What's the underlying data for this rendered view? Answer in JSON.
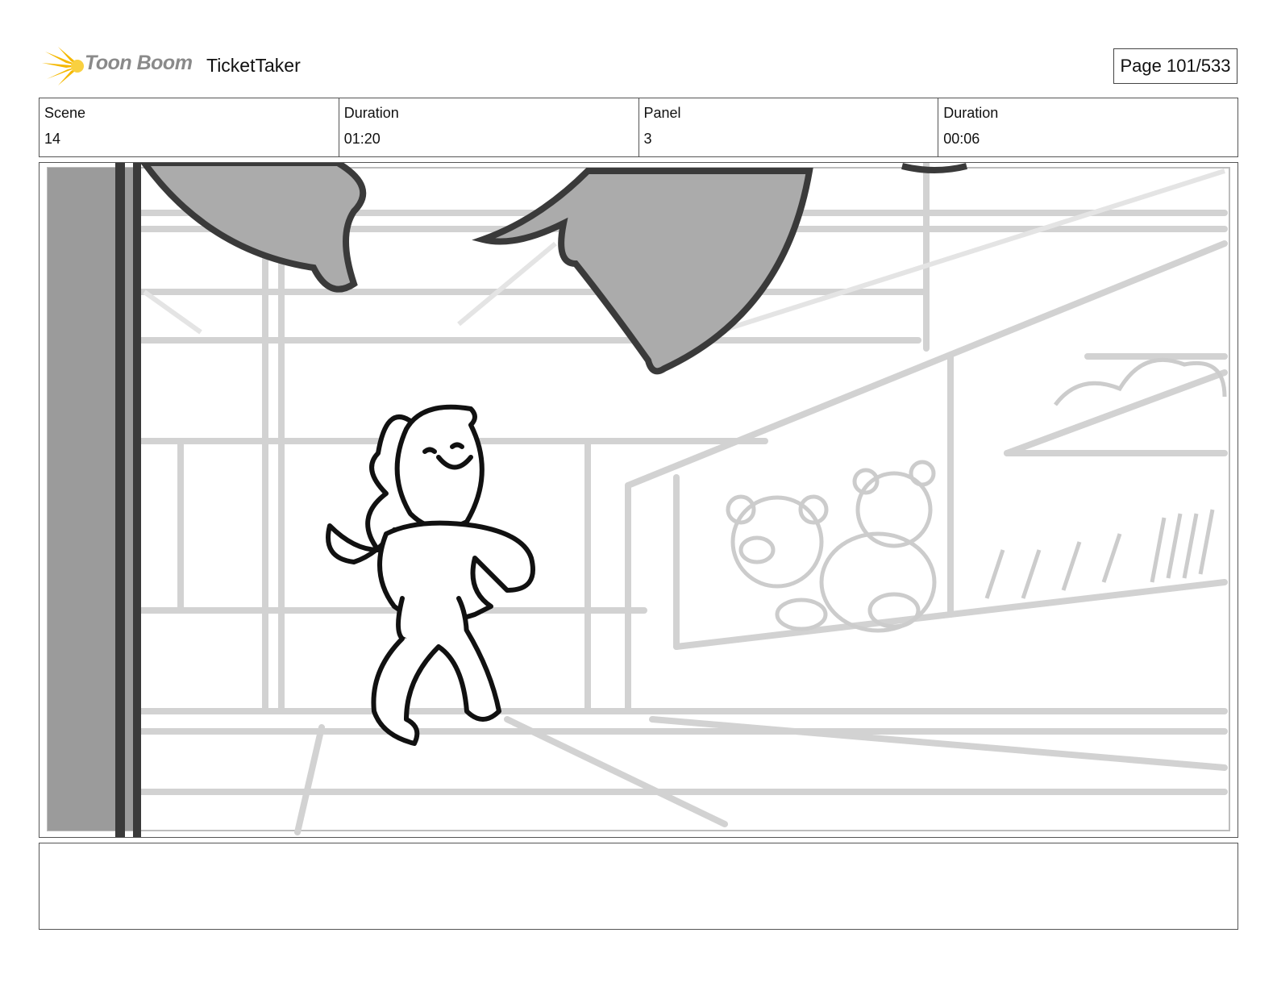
{
  "header": {
    "logo_text": "Toon Boom",
    "project_title": "TicketTaker",
    "page_indicator": "Page 101/533"
  },
  "info": {
    "scene_label": "Scene",
    "scene_value": "14",
    "scene_duration_label": "Duration",
    "scene_duration_value": "01:20",
    "panel_label": "Panel",
    "panel_value": "3",
    "panel_duration_label": "Duration",
    "panel_duration_value": "00:06"
  },
  "notes": {
    "text": ""
  },
  "colors": {
    "logo_accent": "#f5b800",
    "sketch_line": "#111111",
    "background_line": "#cfcfcf",
    "tone_dark": "#9b9b9b"
  },
  "icons": {
    "logo": "toon-boom-star-icon"
  }
}
